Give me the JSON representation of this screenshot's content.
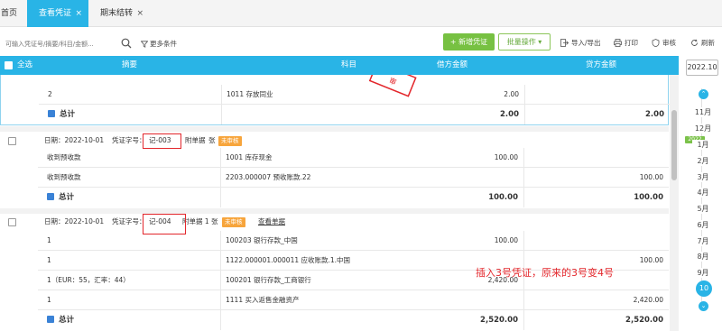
{
  "tabs": [
    {
      "label": "首页"
    },
    {
      "label": "查看凭证",
      "close": "×"
    },
    {
      "label": "期末结转",
      "close": "×"
    }
  ],
  "toolbar": {
    "search_placeholder": "可输入凭证号/摘要/科目/金额...",
    "more_filters": "更多条件",
    "add_voucher": "+ 新增凭证",
    "batch_ops": "批量操作",
    "import_export": "导入/导出",
    "print": "打印",
    "review": "审核",
    "refresh": "刷新"
  },
  "table": {
    "headers": {
      "select_all": "全选",
      "summary": "摘要",
      "subject": "科目",
      "debit": "借方金额",
      "credit": "贷方金额"
    },
    "total_label": "总计",
    "voucher_top": {
      "lines": [
        {
          "summary": "2",
          "subject": "1011 存放同业",
          "debit": "2.00",
          "credit": ""
        }
      ],
      "total_debit": "2.00",
      "total_credit": "2.00"
    },
    "voucher_003": {
      "date": "日期：2022-10-01",
      "word_label": "凭证字号：",
      "number": "记-003",
      "attach": "附单据",
      "attach_unit": "张",
      "status": "未审核",
      "lines": [
        {
          "summary": "收到预收款",
          "subject": "1001 库存现金",
          "debit": "100.00",
          "credit": ""
        },
        {
          "summary": "收到预收款",
          "subject": "2203.000007  预收账款.22",
          "debit": "",
          "credit": "100.00"
        }
      ],
      "total_debit": "100.00",
      "total_credit": "100.00"
    },
    "voucher_004": {
      "date": "日期：2022-10-01",
      "word_label": "凭证字号：",
      "number": "记-004",
      "attach": "附单据 1 张",
      "status": "未审核",
      "view_docs": "查看单据",
      "lines": [
        {
          "summary": "1",
          "subject": "100203 银行存款_中国",
          "debit": "100.00",
          "credit": ""
        },
        {
          "summary": "1",
          "subject": "1122.000001.000011  应收账款.1.中国",
          "debit": "",
          "credit": "100.00"
        },
        {
          "summary": "1（EUR：55，汇率：44）",
          "subject": "100201 银行存款_工商银行",
          "debit": "2,420.00",
          "credit": ""
        },
        {
          "summary": "1",
          "subject": "1111 买入返售金融资产",
          "debit": "",
          "credit": "2,420.00"
        }
      ],
      "total_debit": "2,520.00",
      "total_credit": "2,520.00"
    }
  },
  "annotation": "插入3号凭证，原来的3号变4号",
  "stamp_text": "审",
  "months": {
    "year_select": "2022.10",
    "year_marker": "2022",
    "items": [
      "11月",
      "12月",
      "1月",
      "2月",
      "3月",
      "4月",
      "5月",
      "6月",
      "7月",
      "8月",
      "9月"
    ],
    "current": "10月"
  },
  "colors": {
    "primary": "#29b4e6",
    "add_button": "#77c142",
    "pending_badge": "#f7a53c",
    "annotation_red": "#e3262b"
  }
}
